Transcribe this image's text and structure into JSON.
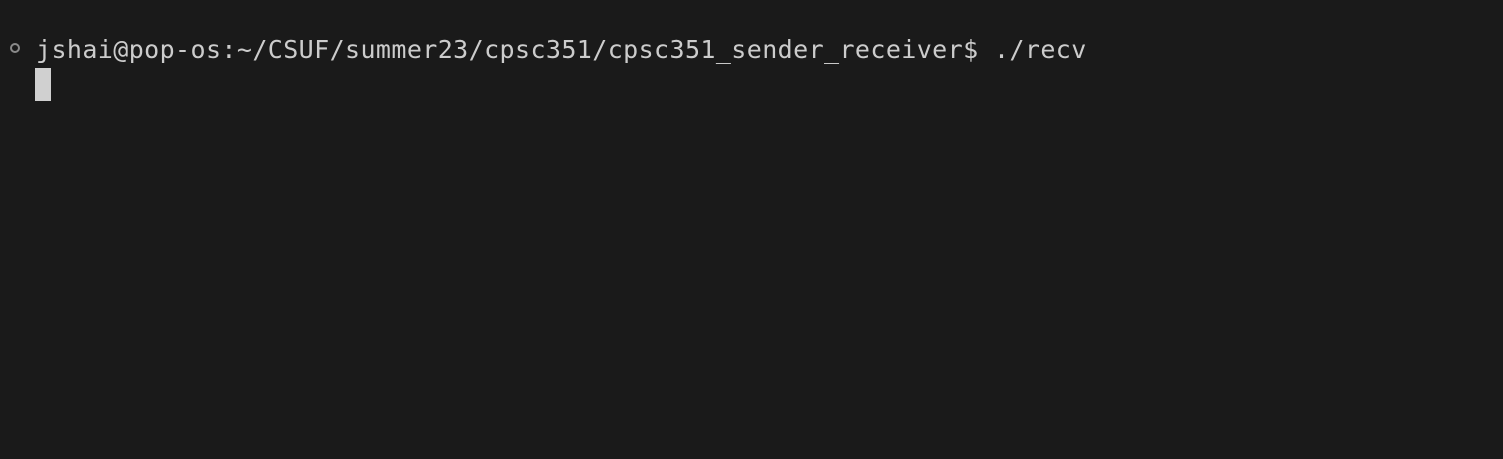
{
  "terminal": {
    "prompt": "jshai@pop-os:~/CSUF/summer23/cpsc351/cpsc351_sender_receiver$",
    "command": " ./recv",
    "decoration_icon": "circle-outline-icon",
    "colors": {
      "background": "#1a1a1a",
      "text": "#cccccc",
      "cursor": "#d0d0d0",
      "decoration": "#8a8a8a"
    }
  }
}
